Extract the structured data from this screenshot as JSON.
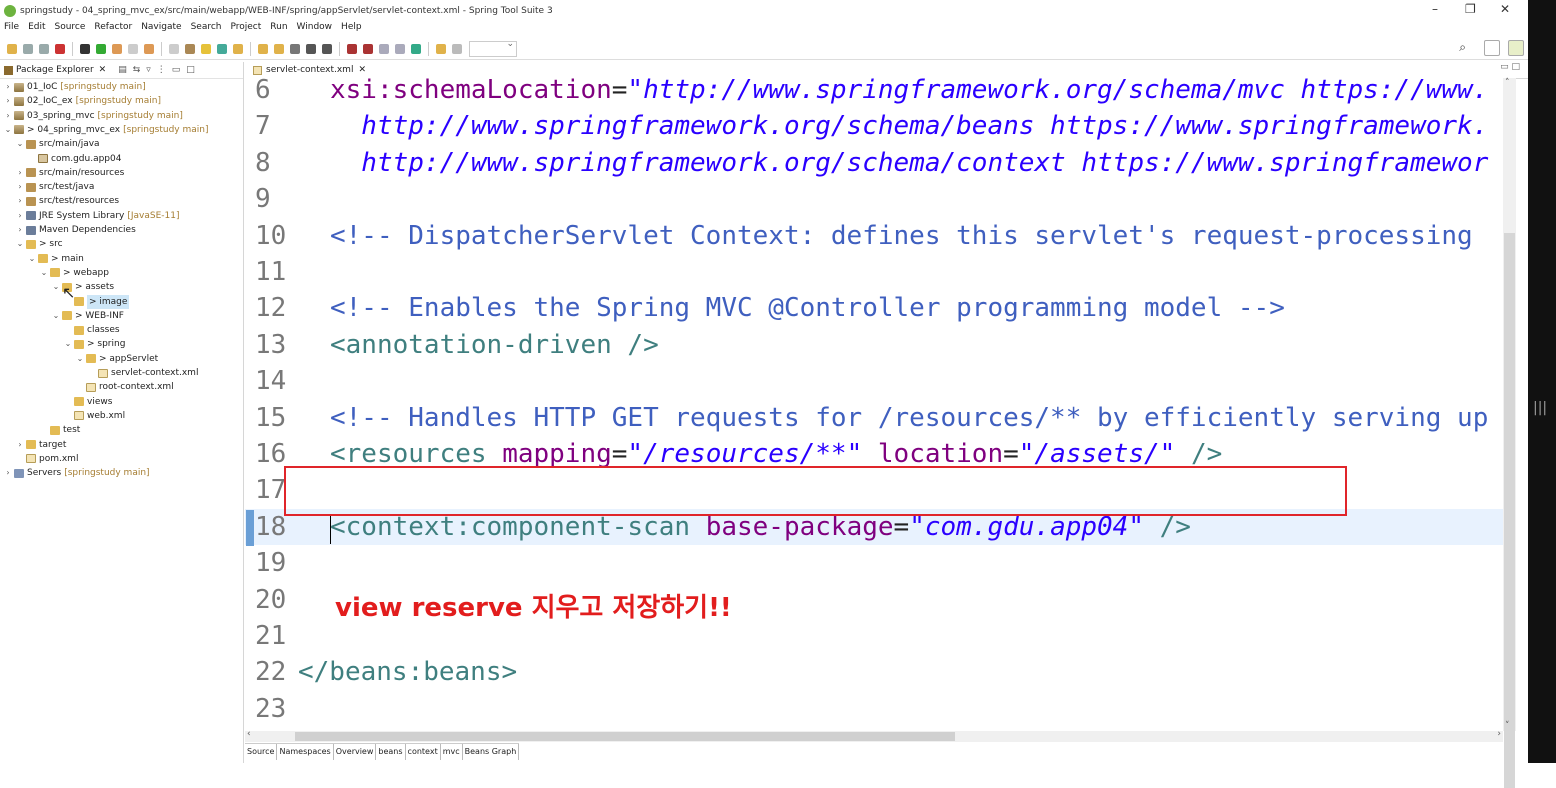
{
  "window": {
    "title": "springstudy - 04_spring_mvc_ex/src/main/webapp/WEB-INF/spring/appServlet/servlet-context.xml - Spring Tool Suite 3",
    "controls": {
      "minimize": "–",
      "maximize": "❐",
      "close": "✕"
    }
  },
  "menu": [
    "File",
    "Edit",
    "Source",
    "Refactor",
    "Navigate",
    "Search",
    "Project",
    "Run",
    "Window",
    "Help"
  ],
  "package_explorer": {
    "title": "Package Explorer",
    "tree": [
      {
        "label": "01_IoC",
        "sub": "[springstudy main]",
        "icon": "ic-proj",
        "chev": ">",
        "indent": 0
      },
      {
        "label": "02_IoC_ex",
        "sub": "[springstudy main]",
        "icon": "ic-proj",
        "chev": ">",
        "indent": 0
      },
      {
        "label": "03_spring_mvc",
        "sub": "[springstudy main]",
        "icon": "ic-proj",
        "chev": ">",
        "indent": 0
      },
      {
        "label": "> 04_spring_mvc_ex",
        "sub": "[springstudy main]",
        "icon": "ic-proj",
        "chev": "v",
        "indent": 0
      },
      {
        "label": "src/main/java",
        "sub": "",
        "icon": "ic-src",
        "chev": "v",
        "indent": 1
      },
      {
        "label": "com.gdu.app04",
        "sub": "",
        "icon": "ic-pkg",
        "chev": "",
        "indent": 2
      },
      {
        "label": "src/main/resources",
        "sub": "",
        "icon": "ic-src",
        "chev": ">",
        "indent": 1
      },
      {
        "label": "src/test/java",
        "sub": "",
        "icon": "ic-src",
        "chev": ">",
        "indent": 1
      },
      {
        "label": "src/test/resources",
        "sub": "",
        "icon": "ic-src",
        "chev": ">",
        "indent": 1
      },
      {
        "label": "JRE System Library",
        "sub": "[JavaSE-11]",
        "icon": "ic-lib",
        "chev": ">",
        "indent": 1
      },
      {
        "label": "Maven Dependencies",
        "sub": "",
        "icon": "ic-lib",
        "chev": ">",
        "indent": 1
      },
      {
        "label": "> src",
        "sub": "",
        "icon": "ic-folder",
        "chev": "v",
        "indent": 1
      },
      {
        "label": "> main",
        "sub": "",
        "icon": "ic-folder",
        "chev": "v",
        "indent": 2
      },
      {
        "label": "> webapp",
        "sub": "",
        "icon": "ic-folder",
        "chev": "v",
        "indent": 3
      },
      {
        "label": "> assets",
        "sub": "",
        "icon": "ic-folder",
        "chev": "v",
        "indent": 4
      },
      {
        "label": "> image",
        "sub": "",
        "icon": "ic-folder",
        "chev": "",
        "indent": 5,
        "selected": true
      },
      {
        "label": "> WEB-INF",
        "sub": "",
        "icon": "ic-folder",
        "chev": "v",
        "indent": 4
      },
      {
        "label": "classes",
        "sub": "",
        "icon": "ic-folder",
        "chev": "",
        "indent": 5
      },
      {
        "label": "> spring",
        "sub": "",
        "icon": "ic-folder",
        "chev": "v",
        "indent": 5
      },
      {
        "label": "> appServlet",
        "sub": "",
        "icon": "ic-folder",
        "chev": "v",
        "indent": 6
      },
      {
        "label": "servlet-context.xml",
        "sub": "",
        "icon": "ic-xml",
        "chev": "",
        "indent": 7
      },
      {
        "label": "root-context.xml",
        "sub": "",
        "icon": "ic-xml",
        "chev": "",
        "indent": 6
      },
      {
        "label": "views",
        "sub": "",
        "icon": "ic-folder",
        "chev": "",
        "indent": 5
      },
      {
        "label": "web.xml",
        "sub": "",
        "icon": "ic-xml",
        "chev": "",
        "indent": 5
      },
      {
        "label": "test",
        "sub": "",
        "icon": "ic-folder",
        "chev": "",
        "indent": 3
      },
      {
        "label": "target",
        "sub": "",
        "icon": "ic-folder",
        "chev": ">",
        "indent": 1
      },
      {
        "label": "pom.xml",
        "sub": "",
        "icon": "ic-xml",
        "chev": "",
        "indent": 1
      },
      {
        "label": "Servers",
        "sub": "[springstudy main]",
        "icon": "ic-srv",
        "chev": ">",
        "indent": 0
      }
    ]
  },
  "editor": {
    "tab_label": "servlet-context.xml",
    "lines": [
      {
        "n": "6",
        "parts": [
          [
            "attr",
            "xsi:schemaLocation"
          ],
          [
            "",
            "="
          ],
          [
            "url",
            "\"http://www.springframework.org/schema/mvc https://www."
          ]
        ]
      },
      {
        "n": "7",
        "parts": [
          [
            "url",
            "  http://www.springframework.org/schema/beans https://www.springframework."
          ]
        ]
      },
      {
        "n": "8",
        "parts": [
          [
            "url",
            "  http://www.springframework.org/schema/context https://www.springframewor"
          ]
        ]
      },
      {
        "n": "9",
        "parts": []
      },
      {
        "n": "10",
        "parts": [
          [
            "cmt",
            "<!-- DispatcherServlet Context: defines this servlet's request-processing"
          ]
        ]
      },
      {
        "n": "11",
        "parts": []
      },
      {
        "n": "12",
        "parts": [
          [
            "cmt",
            "<!-- Enables the Spring MVC @Controller programming model -->"
          ]
        ]
      },
      {
        "n": "13",
        "parts": [
          [
            "tag",
            "<annotation-driven />"
          ]
        ]
      },
      {
        "n": "14",
        "parts": []
      },
      {
        "n": "15",
        "parts": [
          [
            "cmt",
            "<!-- Handles HTTP GET requests for /resources/** by efficiently serving up"
          ]
        ]
      },
      {
        "n": "16",
        "parts": [
          [
            "tag",
            "<resources "
          ],
          [
            "attr",
            "mapping"
          ],
          [
            "",
            "="
          ],
          [
            "val",
            "\"/resources/**\""
          ],
          [
            "tag",
            " "
          ],
          [
            "attr",
            "location"
          ],
          [
            "",
            "="
          ],
          [
            "val",
            "\"/assets/\""
          ],
          [
            "tag",
            " />"
          ]
        ]
      },
      {
        "n": "17",
        "parts": []
      },
      {
        "n": "18",
        "parts": [
          [
            "tag",
            "<context:component-scan "
          ],
          [
            "attr",
            "base-package"
          ],
          [
            "",
            "="
          ],
          [
            "val",
            "\"com.gdu.app04\""
          ],
          [
            "tag",
            " />"
          ]
        ],
        "current": true
      },
      {
        "n": "19",
        "parts": []
      },
      {
        "n": "20",
        "parts": []
      },
      {
        "n": "21",
        "parts": []
      },
      {
        "n": "22",
        "parts": [
          [
            "tag",
            "</beans:beans>"
          ]
        ],
        "shift": true
      },
      {
        "n": "23",
        "parts": []
      }
    ],
    "annotation": "view reserve 지우고 저장하기!!",
    "bottom_tabs": [
      "Source",
      "Namespaces",
      "Overview",
      "beans",
      "context",
      "mvc",
      "Beans Graph"
    ]
  },
  "colors": {
    "accent": "#e0252a",
    "tag": "#3f7f7f",
    "attr": "#7f007f",
    "value": "#2a00ff",
    "comment": "#3f5fbf"
  }
}
